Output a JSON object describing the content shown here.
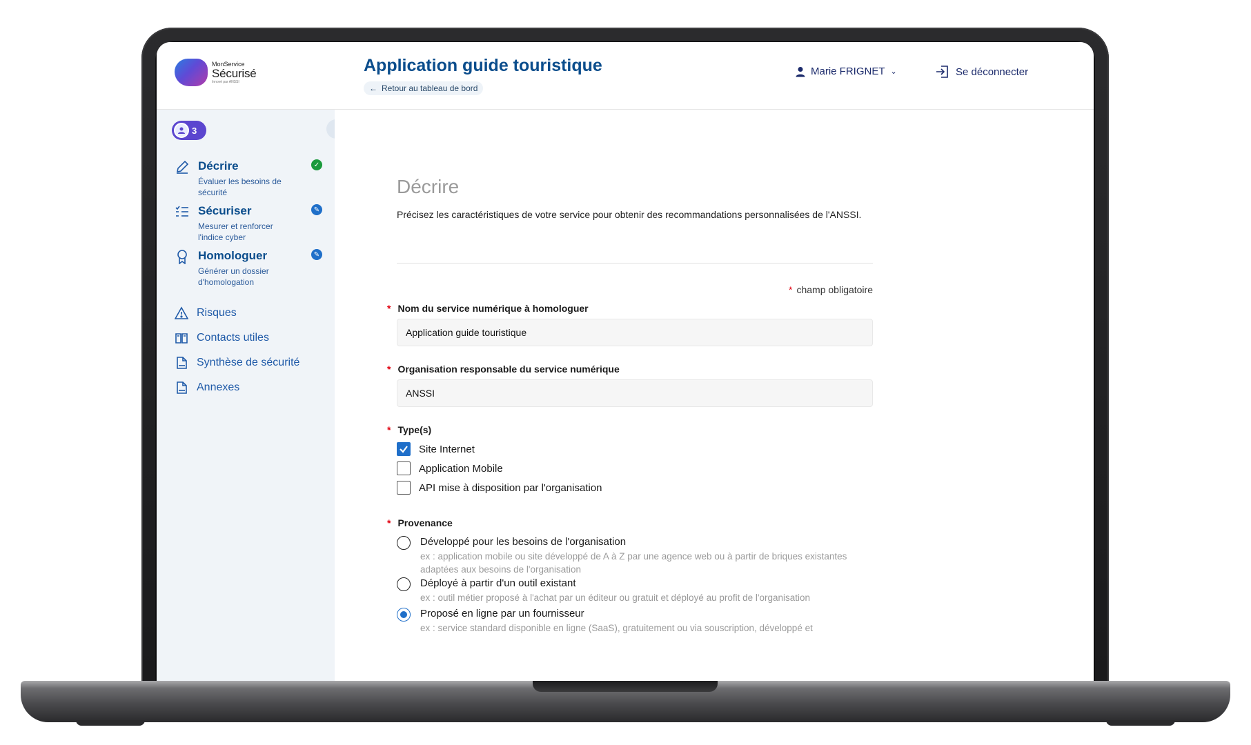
{
  "header": {
    "logo_small": "MonService",
    "logo_big": "Sécurisé",
    "logo_tiny": "Innové par ANSSI",
    "title": "Application guide touristique",
    "back_link": "Retour au tableau de bord",
    "user_name": "Marie FRIGNET",
    "logout_label": "Se déconnecter"
  },
  "sidebar": {
    "contributors_count": "3",
    "steps": [
      {
        "title": "Décrire",
        "desc": "Évaluer les besoins de sécurité",
        "status": "done"
      },
      {
        "title": "Sécuriser",
        "desc": "Mesurer et renforcer l'indice cyber",
        "status": "edit"
      },
      {
        "title": "Homologuer",
        "desc": "Générer un dossier d'homologation",
        "status": "edit"
      }
    ],
    "links": [
      {
        "label": "Risques",
        "icon": "warning-icon"
      },
      {
        "label": "Contacts utiles",
        "icon": "book-icon"
      },
      {
        "label": "Synthèse de sécurité",
        "icon": "pdf-file-icon"
      },
      {
        "label": "Annexes",
        "icon": "pdf-file-icon"
      }
    ]
  },
  "main": {
    "section_title": "Décrire",
    "intro": "Précisez les caractéristiques de votre service pour obtenir des recommandations personnalisées de l'ANSSI.",
    "required_note": "champ obligatoire",
    "fields": {
      "service_name": {
        "label": "Nom du service numérique à homologuer",
        "value": "Application guide touristique"
      },
      "organisation": {
        "label": "Organisation responsable du service numérique",
        "value": "ANSSI"
      }
    },
    "types": {
      "label": "Type(s)",
      "options": [
        {
          "label": "Site Internet",
          "checked": true
        },
        {
          "label": "Application Mobile",
          "checked": false
        },
        {
          "label": "API mise à disposition par l'organisation",
          "checked": false
        }
      ]
    },
    "provenance": {
      "label": "Provenance",
      "options": [
        {
          "label": "Développé pour les besoins de l'organisation",
          "hint": "ex : application mobile ou site développé de A à Z par une agence web ou à partir de briques existantes adaptées aux besoins de l'organisation",
          "selected": false
        },
        {
          "label": "Déployé à partir d'un outil existant",
          "hint": "ex : outil métier proposé à l'achat par un éditeur ou gratuit et déployé au profit de l'organisation",
          "selected": false
        },
        {
          "label": "Proposé en ligne par un fournisseur",
          "hint": "ex : service standard disponible en ligne (SaaS), gratuitement ou via souscription, développé et",
          "selected": true
        }
      ]
    }
  },
  "colors": {
    "primary": "#0b4d8c",
    "accent": "#1f6fc9",
    "success": "#1a9a3c",
    "required": "#e1000f",
    "sidebar_bg": "#f0f4f8"
  }
}
